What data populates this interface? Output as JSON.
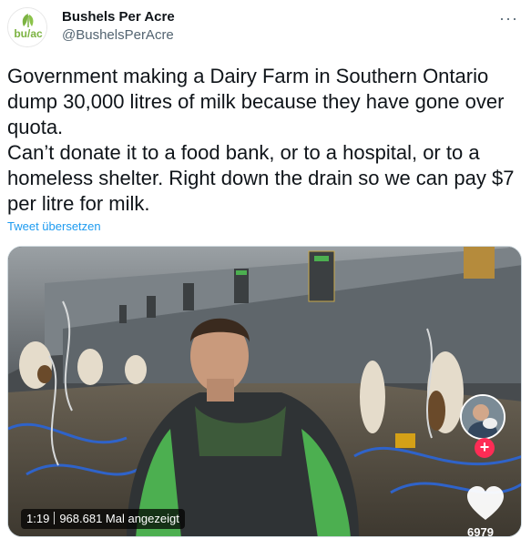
{
  "account": {
    "display_name": "Bushels Per Acre",
    "handle": "@BushelsPerAcre",
    "avatar_text": "bu/ac",
    "more_icon": "ellipsis-icon"
  },
  "tweet": {
    "text": "Government making a Dairy Farm in Southern Ontario dump 30,000 litres of milk because they have gone over quota.\nCan’t donate it to a food bank, or to a hospital, or to a homeless shelter. Right down the drain so we can pay $7 per litre for milk.",
    "translate_label": "Tweet übersetzen"
  },
  "video": {
    "duration": "1:19",
    "views": "968.681 Mal angezeigt",
    "like_count": "6979",
    "plus_icon": "plus-icon",
    "heart_icon": "heart-icon",
    "colors": {
      "accent_link": "#1d9bf0",
      "plus_button": "#fe2c55",
      "logo_green": "#7cb342"
    }
  }
}
